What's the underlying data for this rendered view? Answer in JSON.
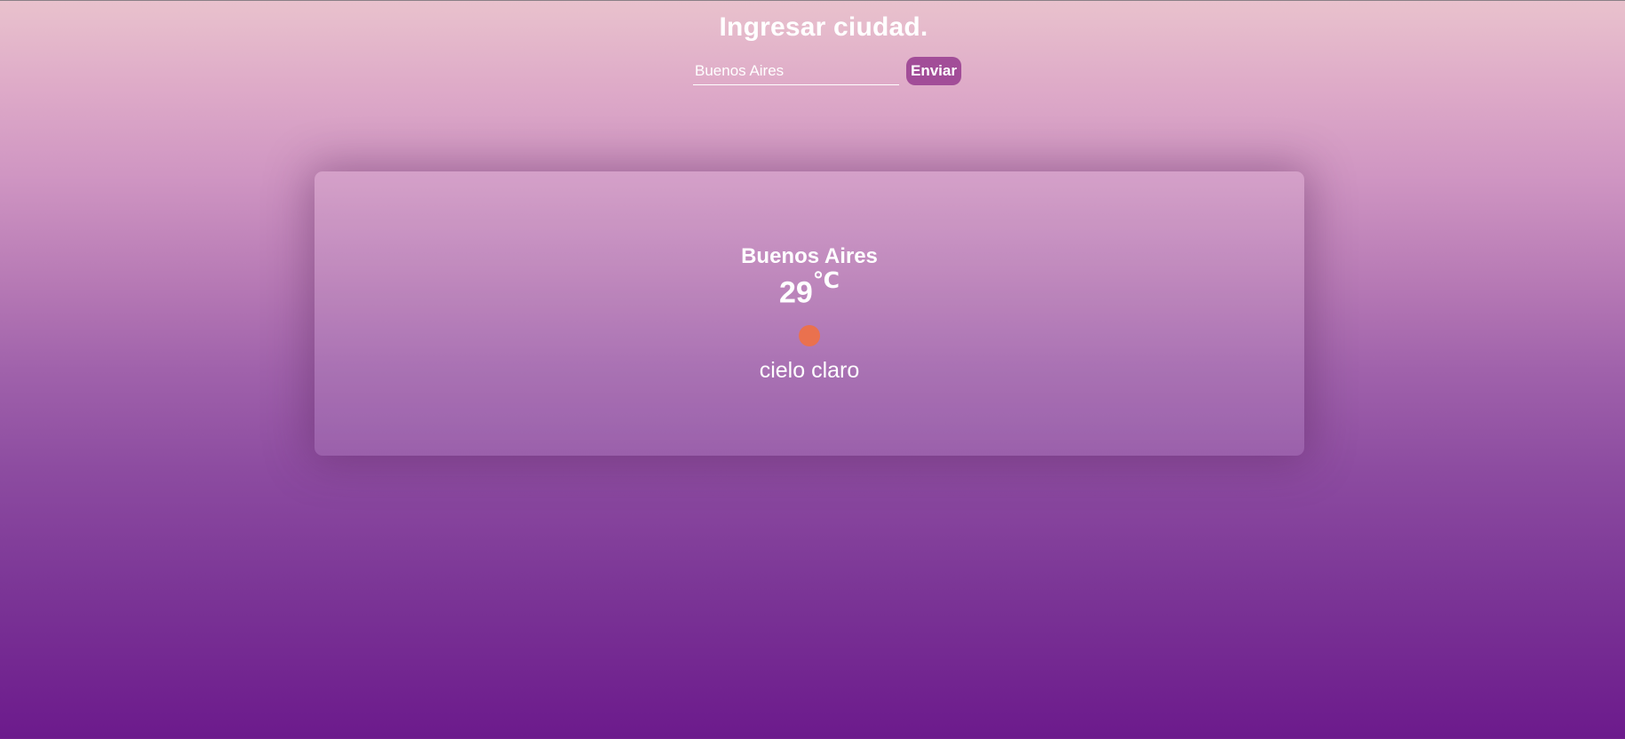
{
  "page": {
    "title": "Ingresar ciudad."
  },
  "search": {
    "value": "Buenos Aires",
    "placeholder": "",
    "submit_label": "Enviar"
  },
  "weather": {
    "city": "Buenos Aires",
    "temperature_value": "29",
    "temperature_unit": "℃",
    "icon": "sun-icon",
    "description": "cielo claro"
  },
  "colors": {
    "accent": "#a24d98",
    "sun": "#ea714e"
  }
}
